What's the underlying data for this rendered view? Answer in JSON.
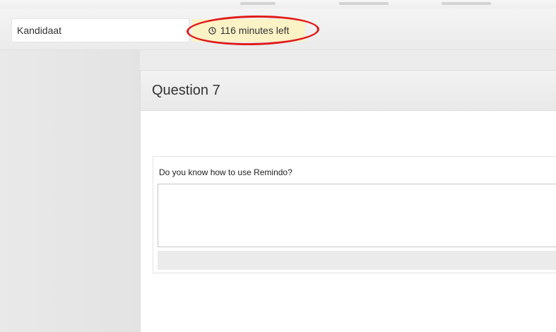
{
  "header": {
    "candidate_label": "Kandidaat",
    "timer_text": "116 minutes left",
    "timer_icon": "clock-icon",
    "highlight_color": "#e01a1a",
    "timer_bg_color": "#fbf2c6"
  },
  "question": {
    "title": "Question 7",
    "text": "Do you know how to use Remindo?",
    "answer_value": ""
  }
}
